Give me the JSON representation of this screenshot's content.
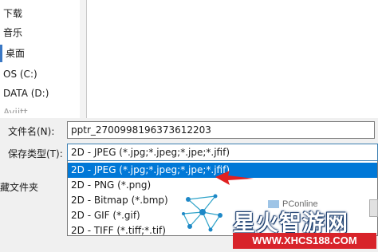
{
  "nav": {
    "items": [
      {
        "label": "下载"
      },
      {
        "label": "音乐"
      },
      {
        "label": "桌面"
      },
      {
        "label": "OS (C:)"
      },
      {
        "label": "DATA (D:)"
      },
      {
        "label": "Ayjitt"
      }
    ]
  },
  "save": {
    "filename_label": "文件名(N):",
    "filename_value": "pptr_2700998196373612203",
    "type_label": "保存类型(T):",
    "type_value": "2D - JPEG (*.jpg;*.jpeg;*.jpe;*.jfif)",
    "options": [
      "2D - JPEG (*.jpg;*.jpeg;*.jpe;*.jfif)",
      "2D - PNG (*.png)",
      "2D - Bitmap (*.bmp)",
      "2D - GIF (*.gif)",
      "2D - TIFF (*.tiff;*.tif)"
    ],
    "highlighted_index": 0,
    "hide_folders_label": "藏文件夹"
  },
  "watermark": {
    "pconline": "PConline",
    "brand": "星火智游网",
    "url": "WWW.XHCS188.COM"
  },
  "colors": {
    "highlight": "#0078d7",
    "arrow": "#e02020",
    "url_bg": "#d8232a"
  }
}
